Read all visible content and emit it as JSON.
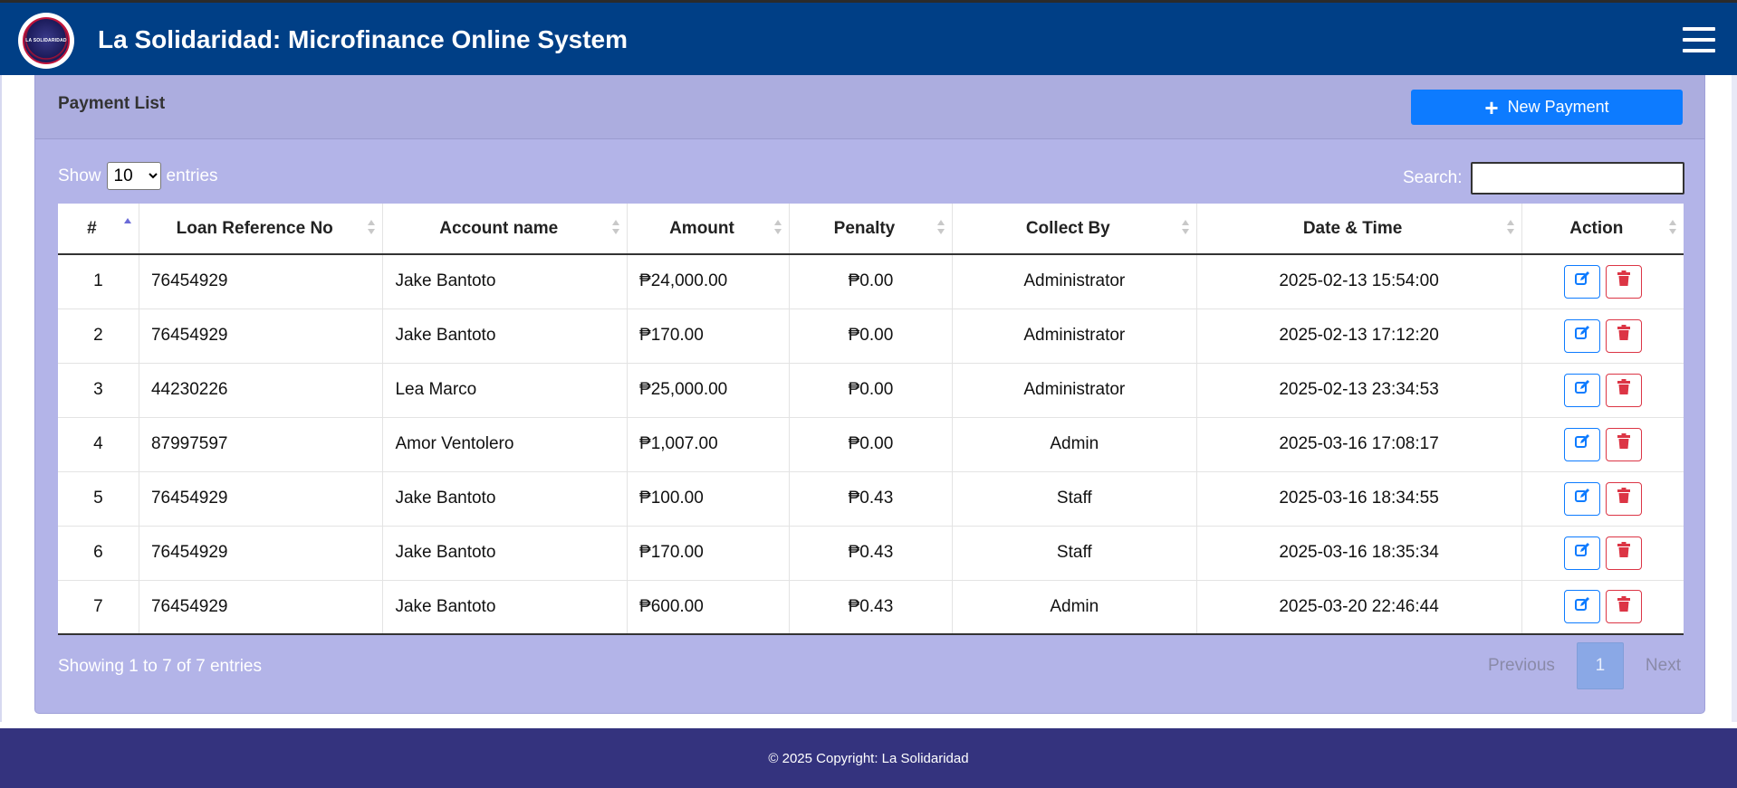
{
  "navbar": {
    "logo_text": "LA SOLIDARIDAD",
    "title": "La Solidaridad: Microfinance Online System"
  },
  "card": {
    "title": "Payment List",
    "new_button_label": "New Payment"
  },
  "length_control": {
    "prefix": "Show",
    "selected": "10",
    "suffix": "entries"
  },
  "search": {
    "label": "Search:",
    "value": ""
  },
  "table": {
    "columns": [
      "#",
      "Loan Reference No",
      "Account name",
      "Amount",
      "Penalty",
      "Collect By",
      "Date & Time",
      "Action"
    ],
    "rows": [
      {
        "num": "1",
        "ref": "76454929",
        "name": "Jake Bantoto",
        "amount": "₱24,000.00",
        "penalty": "₱0.00",
        "collect_by": "Administrator",
        "datetime": "2025-02-13 15:54:00"
      },
      {
        "num": "2",
        "ref": "76454929",
        "name": "Jake Bantoto",
        "amount": "₱170.00",
        "penalty": "₱0.00",
        "collect_by": "Administrator",
        "datetime": "2025-02-13 17:12:20"
      },
      {
        "num": "3",
        "ref": "44230226",
        "name": "Lea Marco",
        "amount": "₱25,000.00",
        "penalty": "₱0.00",
        "collect_by": "Administrator",
        "datetime": "2025-02-13 23:34:53"
      },
      {
        "num": "4",
        "ref": "87997597",
        "name": "Amor Ventolero",
        "amount": "₱1,007.00",
        "penalty": "₱0.00",
        "collect_by": "Admin",
        "datetime": "2025-03-16 17:08:17"
      },
      {
        "num": "5",
        "ref": "76454929",
        "name": "Jake Bantoto",
        "amount": "₱100.00",
        "penalty": "₱0.43",
        "collect_by": "Staff",
        "datetime": "2025-03-16 18:34:55"
      },
      {
        "num": "6",
        "ref": "76454929",
        "name": "Jake Bantoto",
        "amount": "₱170.00",
        "penalty": "₱0.43",
        "collect_by": "Staff",
        "datetime": "2025-03-16 18:35:34"
      },
      {
        "num": "7",
        "ref": "76454929",
        "name": "Jake Bantoto",
        "amount": "₱600.00",
        "penalty": "₱0.43",
        "collect_by": "Admin",
        "datetime": "2025-03-20 22:46:44"
      }
    ]
  },
  "info_text": "Showing 1 to 7 of 7 entries",
  "pagination": {
    "previous": "Previous",
    "current": "1",
    "next": "Next"
  },
  "footer": {
    "text": "© 2025 Copyright: La Solidaridad"
  },
  "icons": {
    "edit": "pen-square-icon",
    "delete": "trash-icon",
    "menu": "hamburger-menu-icon",
    "add": "plus-icon"
  },
  "colors": {
    "navbar": "#003f86",
    "card": "#b3b4e8",
    "primary": "#0d7bff",
    "danger": "#dc3545",
    "footer": "#34337e"
  }
}
